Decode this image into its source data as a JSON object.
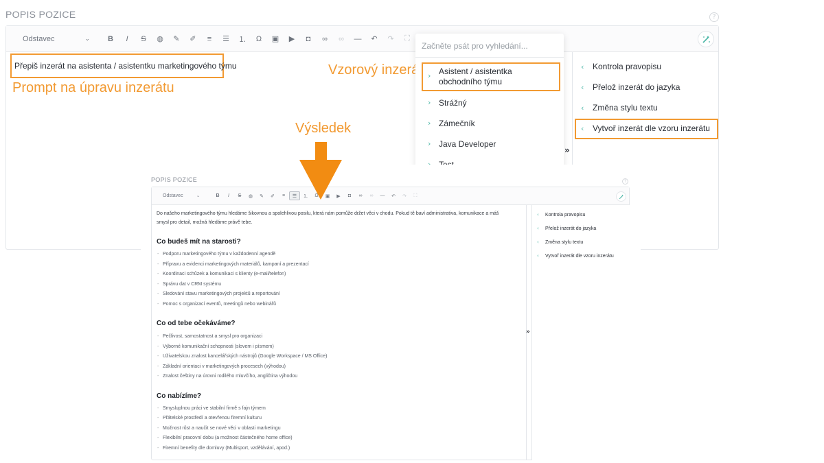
{
  "top": {
    "section_label": "POPIS POZICE",
    "help_icon": "?",
    "format_select": "Odstavec",
    "editor_text": "Přepiš inzerát na asistenta / asistentku marketingového týmu",
    "prompt_label": "Prompt na úpravu inzerátu",
    "template_label": "Vzorový inzerát",
    "dropdown": {
      "placeholder": "Začněte psát pro vyhledání...",
      "items": [
        "Asistent / asistentka obchodního týmu",
        "Strážný",
        "Zámečník",
        "Java Developer",
        "Test"
      ]
    },
    "actions": [
      "Kontrola pravopisu",
      "Přelož inzerát do jazyka",
      "Změna stylu textu",
      "Vytvoř inzerát dle vzoru inzerátu"
    ],
    "collapse": "»"
  },
  "result_label": "Výsledek",
  "bottom": {
    "section_label": "POPIS POZICE",
    "format_select": "Odstavec",
    "intro": [
      "Do našeho marketingového týmu hledáme šikovnou a spolehlivou posilu, která nám pomůže držet věci v chodu. Pokud tě baví administrativa, komunikace a máš",
      "smysl pro detail, možná hledáme právě tebe."
    ],
    "sections": [
      {
        "heading": "Co budeš mít na starosti?",
        "items": [
          "Podporu marketingového týmu v každodenní agendě",
          "Přípravu a evidenci marketingových materiálů, kampaní a prezentací",
          "Koordinaci schůzek a komunikaci s klienty (e-mail/telefon)",
          "Správu dat v CRM systému",
          "Sledování stavu marketingových projektů a reportování",
          "Pomoc s organizací eventů, meetingů nebo webinářů"
        ]
      },
      {
        "heading": "Co od tebe očekáváme?",
        "items": [
          "Pečlivost, samostatnost a smysl pro organizaci",
          "Výborné komunikační schopnosti (slovem i písmem)",
          "Uživatelskou znalost kancelářských nástrojů (Google Workspace / MS Office)",
          "Základní orientaci v marketingových procesech (výhodou)",
          "Znalost češtiny na úrovni rodilého mluvčího, angličtina výhodou"
        ]
      },
      {
        "heading": "Co nabízíme?",
        "items": [
          "Smysluplnou práci ve stabilní firmě s fajn týmem",
          "Přátelské prostředí a otevřenou firemní kulturu",
          "Možnost růst a naučit se nové věci v oblasti marketingu",
          "Flexibilní pracovní dobu (a možnost částečného home office)",
          "Firemní benefity dle domluvy (Multisport, vzdělávání, apod.)"
        ]
      }
    ],
    "actions": [
      "Kontrola pravopisu",
      "Přelož inzerát do jazyka",
      "Změna stylu textu",
      "Vytvoř inzerát dle vzoru inzerátu"
    ],
    "collapse": "»"
  },
  "colors": {
    "accent_orange": "#f29a32",
    "chevron_teal": "#4bb6a6"
  },
  "toolbar_icons": [
    "bold-icon",
    "italic-icon",
    "strikethrough-icon",
    "palette-icon",
    "highlighter-icon",
    "text-color-icon",
    "bullet-list-icon",
    "list-icon",
    "numbered-list-icon",
    "omega-icon",
    "image-icon",
    "video-icon",
    "embed-icon",
    "link-icon",
    "unlink-icon",
    "horizontal-rule-icon",
    "undo-icon",
    "redo-icon",
    "fullscreen-icon"
  ]
}
